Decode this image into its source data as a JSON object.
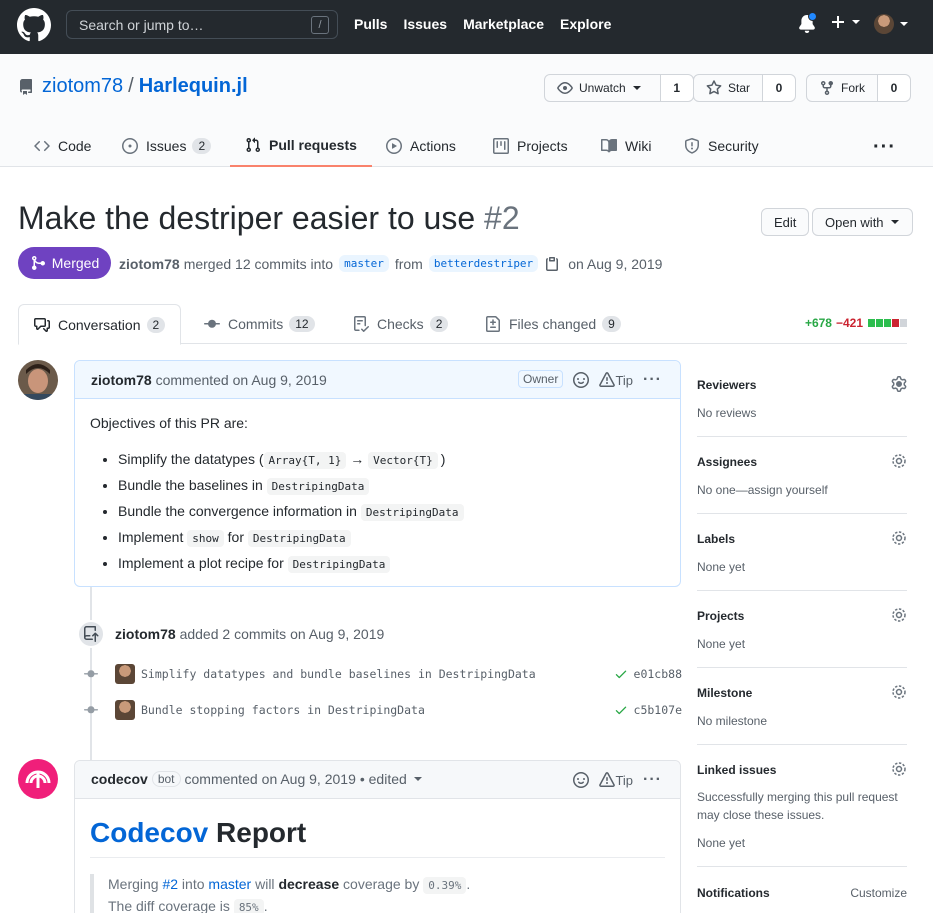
{
  "header": {
    "search_placeholder": "Search or jump to…",
    "search_shortcut": "/",
    "nav": [
      "Pulls",
      "Issues",
      "Marketplace",
      "Explore"
    ]
  },
  "repo": {
    "owner": "ziotom78",
    "separator": "/",
    "name": "Harlequin.jl",
    "watch": {
      "label": "Unwatch",
      "count": "1"
    },
    "star": {
      "label": "Star",
      "count": "0"
    },
    "fork": {
      "label": "Fork",
      "count": "0"
    },
    "tabs": [
      {
        "label": "Code"
      },
      {
        "label": "Issues",
        "count": "2"
      },
      {
        "label": "Pull requests"
      },
      {
        "label": "Actions"
      },
      {
        "label": "Projects"
      },
      {
        "label": "Wiki"
      },
      {
        "label": "Security"
      }
    ],
    "more": "···"
  },
  "pr": {
    "title": "Make the destriper easier to use",
    "number": "#2",
    "edit_label": "Edit",
    "open_with_label": "Open with",
    "state": "Merged",
    "meta": {
      "author": "ziotom78",
      "action": "merged 12 commits into",
      "base": "master",
      "from": "from",
      "head": "betterdestriper",
      "date": "on Aug 9, 2019"
    },
    "tabs": [
      {
        "label": "Conversation",
        "count": "2"
      },
      {
        "label": "Commits",
        "count": "12"
      },
      {
        "label": "Checks",
        "count": "2"
      },
      {
        "label": "Files changed",
        "count": "9"
      }
    ],
    "diffstat": {
      "additions": "+678",
      "deletions": "−421"
    }
  },
  "comment1": {
    "author": "ziotom78",
    "action": "commented",
    "date": "on Aug 9, 2019",
    "role": "Owner",
    "tip": "Tip",
    "intro": "Objectives of this PR are:",
    "items": [
      {
        "text": "Simplify the datatypes (",
        "code1": "Array{T, 1}",
        "mid": " → ",
        "code2": "Vector{T}",
        "end": ")"
      },
      {
        "text": "Bundle the baselines in ",
        "code1": "DestripingData"
      },
      {
        "text": "Bundle the convergence information in ",
        "code1": "DestripingData"
      },
      {
        "text": "Implement ",
        "code1": "show",
        "mid": " for ",
        "code2": "DestripingData"
      },
      {
        "text": "Implement a plot recipe for ",
        "code1": "DestripingData"
      }
    ]
  },
  "commits_event": {
    "author": "ziotom78",
    "action": "added 2 commits",
    "date": "on Aug 9, 2019",
    "commits": [
      {
        "message": "Simplify datatypes and bundle baselines in DestripingData",
        "sha": "e01cb88"
      },
      {
        "message": "Bundle stopping factors in DestripingData",
        "sha": "c5b107e"
      }
    ]
  },
  "comment2": {
    "author": "codecov",
    "bot_label": "bot",
    "action": "commented",
    "date": "on Aug 9, 2019",
    "edited": "• edited",
    "tip": "Tip",
    "report_title_link": "Codecov",
    "report_title_rest": "Report",
    "line1": {
      "a": "Merging ",
      "pr": "#2",
      "b": " into ",
      "base": "master",
      "c": " will ",
      "verb": "decrease",
      "d": " coverage by ",
      "value": "0.39%",
      "e": "."
    },
    "line2": {
      "a": "The diff coverage is ",
      "value": "85%",
      "b": "."
    }
  },
  "sidebar": [
    {
      "heading": "Reviewers",
      "value": "No reviews"
    },
    {
      "heading": "Assignees",
      "value": "No one—assign yourself"
    },
    {
      "heading": "Labels",
      "value": "None yet"
    },
    {
      "heading": "Projects",
      "value": "None yet"
    },
    {
      "heading": "Milestone",
      "value": "No milestone"
    },
    {
      "heading": "Linked issues",
      "value": "Successfully merging this pull request may close these issues.",
      "value2": "None yet"
    },
    {
      "heading": "Notifications",
      "action": "Customize"
    }
  ],
  "colors": {
    "header_bg": "#24292e",
    "link": "#0366d6",
    "merged": "#6f42c1",
    "additions": "#28a745",
    "deletions": "#cb2431",
    "selected_tab_underline": "#f9826c",
    "codecov": "#f01f7a"
  },
  "icons": {
    "logo": "github-mark-icon",
    "bell": "bell-icon",
    "plus": "plus-icon",
    "repo": "repo-icon",
    "eye": "eye-icon",
    "star": "star-icon",
    "fork": "fork-icon",
    "merge": "git-merge-icon",
    "copy": "clipboard-icon",
    "gear": "gear-icon",
    "smiley": "smiley-icon",
    "check": "check-icon"
  }
}
